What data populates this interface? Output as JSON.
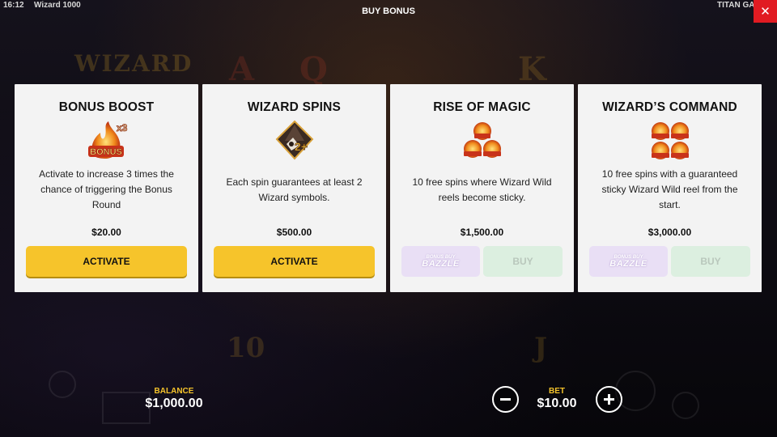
{
  "topbar": {
    "time": "16:12",
    "game_title": "Wizard 1000",
    "dialog_title": "BUY BONUS",
    "provider": "TITAN GAMING",
    "close_symbol": "✕"
  },
  "background": {
    "logo_text": "WIZARD"
  },
  "cards": [
    {
      "title": "BONUS BOOST",
      "icon": "bonus-x3-icon",
      "description": "Activate to increase 3 times the chance of triggering the Bonus Round",
      "price": "$20.00",
      "button_label": "ACTIVATE"
    },
    {
      "title": "WIZARD SPINS",
      "icon": "wizard-2plus-icon",
      "description": "Each spin guarantees at least 2 Wizard symbols.",
      "price": "$500.00",
      "button_label": "ACTIVATE"
    },
    {
      "title": "RISE OF MAGIC",
      "icon": "bonus-triple-icon",
      "description": "10 free spins where Wizard Wild reels become sticky.",
      "price": "$1,500.00",
      "bazzle_top": "BONUS BUY",
      "bazzle_bottom": "BAZZLE",
      "buy_label": "BUY"
    },
    {
      "title": "WIZARD’S COMMAND",
      "icon": "bonus-quad-icon",
      "description": "10 free spins with a guaranteed sticky Wizard Wild reel from the start.",
      "price": "$3,000.00",
      "bazzle_top": "BONUS BUY",
      "bazzle_bottom": "BAZZLE",
      "buy_label": "BUY"
    }
  ],
  "bottom": {
    "balance_label": "BALANCE",
    "balance_value": "$1,000.00",
    "bet_label": "BET",
    "bet_value": "$10.00"
  },
  "colors": {
    "accent_yellow": "#f6c42b",
    "close_red": "#e11b22",
    "card_bg": "#f3f3f3",
    "disabled_green": "#dcefe0",
    "bazzle_purple": "#e9dff5"
  }
}
